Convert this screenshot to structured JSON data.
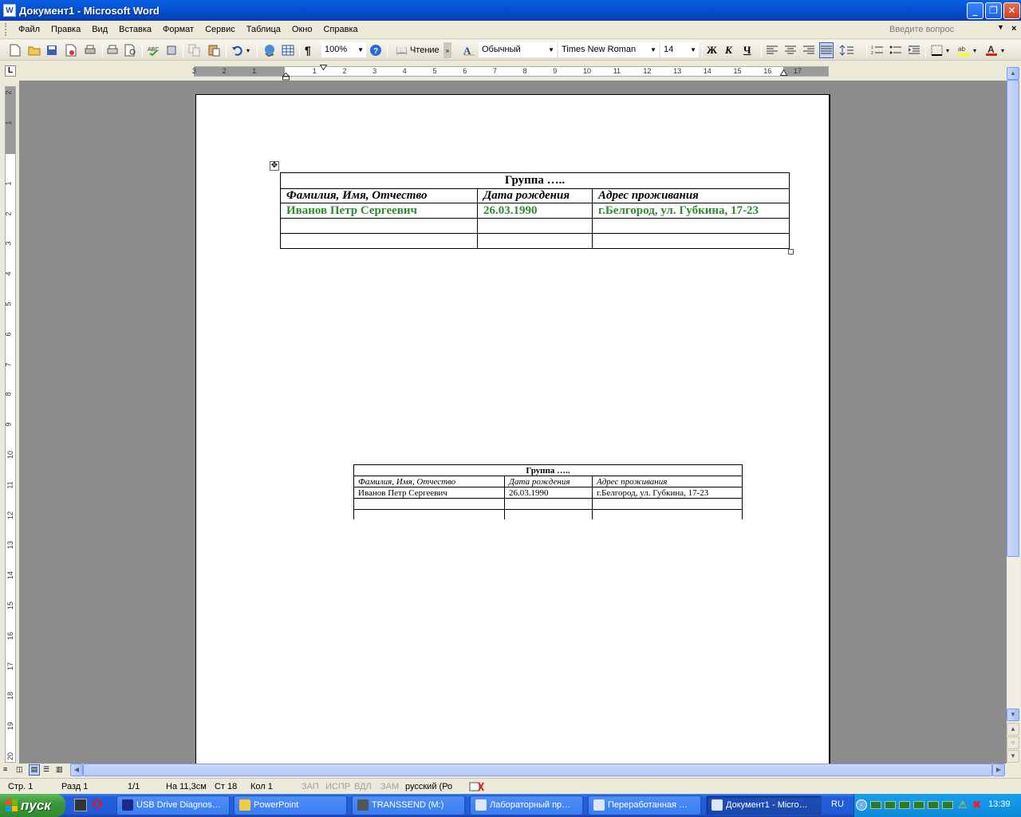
{
  "window": {
    "title": "Документ1 - Microsoft Word",
    "app_icon": "word-icon"
  },
  "menu": {
    "items": [
      "Файл",
      "Правка",
      "Вид",
      "Вставка",
      "Формат",
      "Сервис",
      "Таблица",
      "Окно",
      "Справка"
    ],
    "ask_placeholder": "Введите вопрос"
  },
  "toolbar": {
    "zoom": "100%",
    "reading": "Чтение",
    "style": "Обычный",
    "font": "Times New Roman",
    "size": "14",
    "bold": "Ж",
    "italic": "К",
    "underline": "Ч"
  },
  "ruler": {
    "h_marks": [
      "3",
      "2",
      "1",
      "1",
      "2",
      "3",
      "4",
      "5",
      "6",
      "7",
      "8",
      "9",
      "10",
      "11",
      "12",
      "13",
      "14",
      "15",
      "16",
      "17"
    ],
    "v_marks": [
      "2",
      "1",
      "1",
      "2",
      "3",
      "4",
      "5",
      "6",
      "7",
      "8",
      "9",
      "10",
      "11",
      "12",
      "13",
      "14",
      "15",
      "16",
      "17",
      "18",
      "19",
      "20"
    ],
    "tab_stop": "L"
  },
  "table_main": {
    "title": "Группа …..",
    "headers": [
      "Фамилия, Имя, Отчество",
      "Дата рождения",
      "Адрес проживания"
    ],
    "rows": [
      [
        "Иванов Петр Сергеевич",
        "26.03.1990",
        "г.Белгород, ул. Губкина, 17-23"
      ],
      [
        "",
        "",
        ""
      ],
      [
        "",
        "",
        ""
      ]
    ],
    "data_color": "#2e8b2e"
  },
  "table_small": {
    "title": "Группа …..",
    "headers": [
      "Фамилия, Имя, Отчество",
      "Дата рождения",
      "Адрес проживания"
    ],
    "rows": [
      [
        "Иванов Петр Сергеевич",
        "26.03.1990",
        "г.Белгород, ул. Губкина, 17-23"
      ],
      [
        "",
        "",
        ""
      ],
      [
        "",
        "",
        ""
      ]
    ]
  },
  "status": {
    "page": "Стр. 1",
    "section": "Разд 1",
    "pages": "1/1",
    "at": "На 11,3см",
    "line": "Ст 18",
    "col": "Кол 1",
    "rec": "ЗАП",
    "trk": "ИСПР",
    "ext": "ВДЛ",
    "ovr": "ЗАМ",
    "lang": "русский (Ро"
  },
  "taskbar": {
    "start": "пуск",
    "tasks": [
      "USB Drive Diagnos…",
      "PowerPoint",
      "TRANSSEND (M:)",
      "Лабораторный пр…",
      "Переработанная …",
      "Документ1 - Micro…"
    ],
    "lang": "RU",
    "clock": "13:39"
  }
}
